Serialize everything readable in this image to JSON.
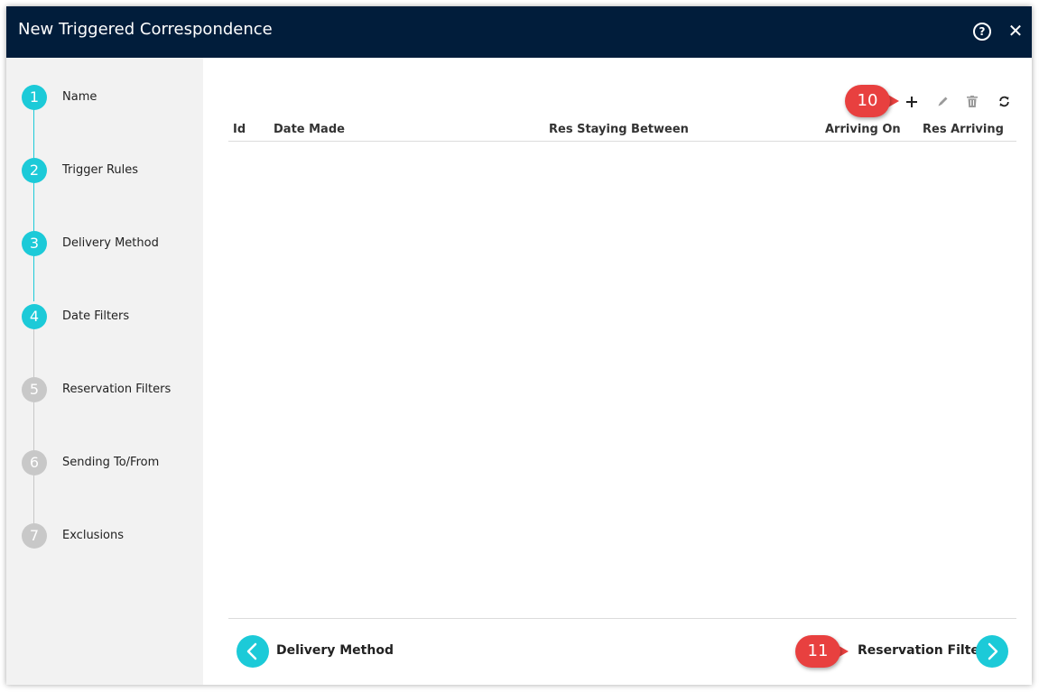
{
  "dialog": {
    "title": "New Triggered Correspondence",
    "help_icon": "question-circle-icon",
    "close_icon": "close-icon"
  },
  "steps": [
    {
      "number": "1",
      "label": "Name",
      "state": "complete"
    },
    {
      "number": "2",
      "label": "Trigger Rules",
      "state": "complete"
    },
    {
      "number": "3",
      "label": "Delivery Method",
      "state": "complete"
    },
    {
      "number": "4",
      "label": "Date Filters",
      "state": "active"
    },
    {
      "number": "5",
      "label": "Reservation Filters",
      "state": "pending"
    },
    {
      "number": "6",
      "label": "Sending To/From",
      "state": "pending"
    },
    {
      "number": "7",
      "label": "Exclusions",
      "state": "pending"
    }
  ],
  "toolbar": {
    "add_icon": "plus-icon",
    "edit_icon": "pencil-icon",
    "delete_icon": "trash-icon",
    "refresh_icon": "refresh-icon"
  },
  "table": {
    "columns": [
      "Id",
      "Date Made",
      "Res Staying Between",
      "Arriving On",
      "Res Arriving"
    ],
    "rows": []
  },
  "footer": {
    "back_label": "Delivery Method",
    "next_label": "Reservation Filters"
  },
  "callouts": {
    "add": "10",
    "next": "11"
  },
  "colors": {
    "titlebar": "#011d3b",
    "accent": "#1ccad8",
    "pending": "#c8c8c8",
    "callout": "#e8403f"
  }
}
